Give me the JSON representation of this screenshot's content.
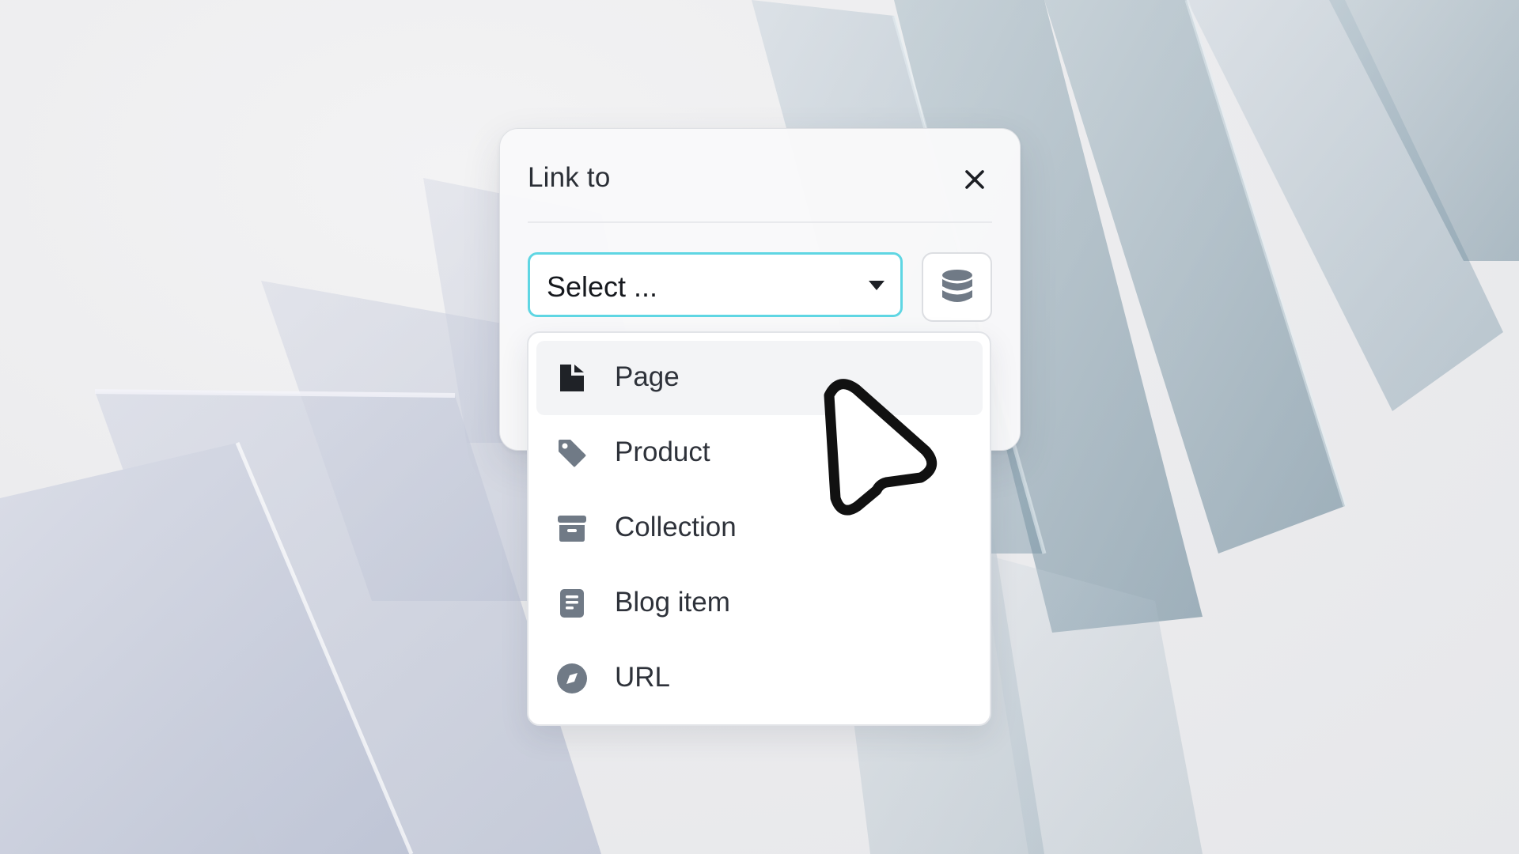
{
  "dialog": {
    "title": "Link to",
    "close_icon": "close-icon"
  },
  "select": {
    "value": "Select ...",
    "caret_icon": "caret-down-icon"
  },
  "data_source_button": {
    "icon": "database-icon"
  },
  "menu": {
    "items": [
      {
        "label": "Page",
        "icon": "page-icon",
        "active": true
      },
      {
        "label": "Product",
        "icon": "tag-icon",
        "active": false
      },
      {
        "label": "Collection",
        "icon": "archive-icon",
        "active": false
      },
      {
        "label": "Blog item",
        "icon": "document-icon",
        "active": false
      },
      {
        "label": "URL",
        "icon": "compass-icon",
        "active": false
      }
    ]
  },
  "colors": {
    "accent_border": "#5fd6e3",
    "icon_gray": "#707a86",
    "text_dark": "#2e323a",
    "hover_bg": "#f3f4f6"
  }
}
